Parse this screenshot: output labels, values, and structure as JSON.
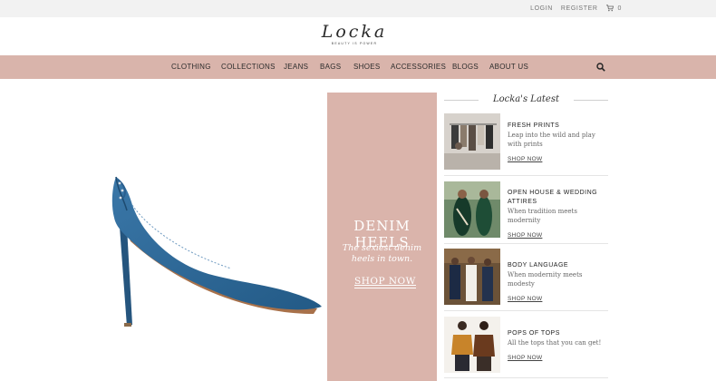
{
  "topbar": {
    "login": "LOGIN",
    "register": "REGISTER",
    "cart_count": "0"
  },
  "logo": {
    "name": "Locka",
    "tagline": "BEAUTY IS POWER"
  },
  "nav": {
    "items": [
      "CLOTHING",
      "COLLECTIONS",
      "JEANS",
      "BAGS",
      "SHOES",
      "ACCESSORIES",
      "BLOGS",
      "ABOUT US"
    ]
  },
  "promo": {
    "title": "DENIM HEELS",
    "subtitle": "The sexiest denim heels in town.",
    "cta": "SHOP NOW"
  },
  "latest": {
    "heading": "Locka's Latest",
    "posts": [
      {
        "title": "FRESH PRINTS",
        "desc": "Leap into the wild and play with prints",
        "link": "SHOP NOW"
      },
      {
        "title": "OPEN HOUSE & WEDDING ATTIRES",
        "desc": "When tradition meets modernity",
        "link": "SHOP NOW"
      },
      {
        "title": "BODY LANGUAGE",
        "desc": "When modernity meets modesty",
        "link": "SHOP NOW"
      },
      {
        "title": "POPS OF TOPS",
        "desc": "All the tops that you can get!",
        "link": "SHOP NOW"
      }
    ]
  },
  "colors": {
    "nav_bg": "#d9b4ab",
    "promo_bg": "#dab4ab",
    "denim": "#2f6795"
  }
}
